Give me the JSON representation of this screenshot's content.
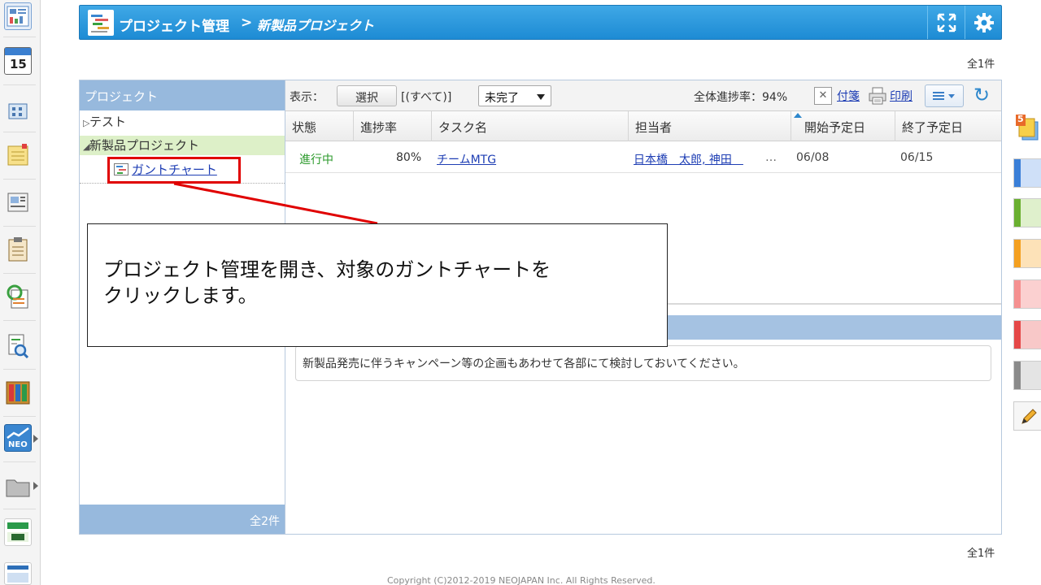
{
  "header": {
    "title": "プロジェクト管理",
    "separator": ">",
    "project_name": "新製品プロジェクト",
    "fullscreen_icon": "expand-icon",
    "settings_icon": "gear-icon"
  },
  "counts": {
    "top": "全1件",
    "bottom": "全1件"
  },
  "project_panel": {
    "header": "プロジェクト",
    "items": [
      {
        "label": "テスト",
        "expanded": false
      },
      {
        "label": "新製品プロジェクト",
        "expanded": true
      }
    ],
    "child_item": {
      "label": "ガントチャート",
      "icon": "gantt-chart-icon"
    },
    "footer_count": "全2件"
  },
  "toolbar": {
    "display_label": "表示：",
    "select_button": "選択",
    "filter_text": "[(すべて)]",
    "status_select": "未完了",
    "progress_text": "全体進捗率：94%",
    "sticky_link": "付箋",
    "print_link": "印刷"
  },
  "table": {
    "columns": [
      "状態",
      "進捗率",
      "タスク名",
      "担当者",
      "開始予定日",
      "終了予定日"
    ],
    "rows": [
      {
        "status": "進行中",
        "progress": "80%",
        "task": "チームMTG",
        "assignee": "日本橋　太郎, 神田　",
        "assignee_more": "…",
        "start": "06/08",
        "end": "06/15"
      }
    ]
  },
  "detail": {
    "memo": "新製品発売に伴うキャンペーン等の企画もあわせて各部にて検討しておいてください。"
  },
  "callout": {
    "line1": "プロジェクト管理を開き、対象のガントチャートを",
    "line2": "クリックします。"
  },
  "footer": {
    "copyright": "Copyright (C)2012-2019 NEOJAPAN Inc. All Rights Reserved."
  },
  "leftbar": {
    "calendar_day": "15",
    "neo_label": "NEO"
  },
  "rightbar": {
    "badge_count": "5"
  },
  "colors": {
    "accent": "#1d8bd4",
    "panel_header": "#97b9dd",
    "selected_row": "#ddf0c8",
    "callout_red": "#e00000",
    "status_green": "#2b9a2b"
  }
}
